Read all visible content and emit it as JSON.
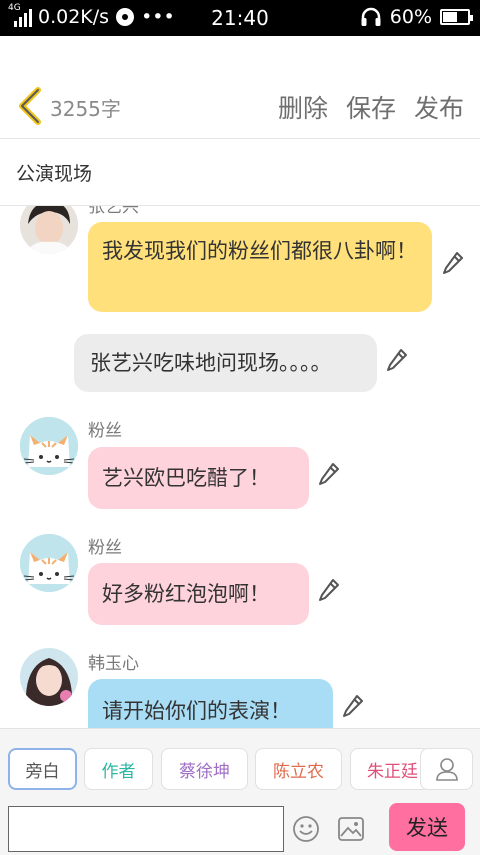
{
  "status_bar": {
    "network": "4G",
    "speed": "0.02K/s",
    "dots": "•••",
    "time": "21:40",
    "battery": "60%",
    "battery_level": 0.6
  },
  "header": {
    "word_count": "3255字",
    "delete": "删除",
    "save": "保存",
    "publish": "发布"
  },
  "title": "公演现场",
  "messages": [
    {
      "name": "张艺兴",
      "text": "我发现我们的粉丝们都很八卦啊！",
      "bubble_color": "#ffe07a"
    },
    {
      "name": "",
      "text": "张艺兴吃味地问现场。。。。",
      "bubble_color": "#ececec"
    },
    {
      "name": "粉丝",
      "text": "艺兴欧巴吃醋了！",
      "bubble_color": "#ffd3dc"
    },
    {
      "name": "粉丝",
      "text": "好多粉红泡泡啊！",
      "bubble_color": "#ffd3dc"
    },
    {
      "name": "韩玉心",
      "text": "请开始你们的表演！",
      "bubble_color": "#a9dcf5"
    }
  ],
  "roles": [
    {
      "label": "旁白",
      "color": "#555555"
    },
    {
      "label": "作者",
      "color": "#2bb7a4"
    },
    {
      "label": "蔡徐坤",
      "color": "#a06fc4"
    },
    {
      "label": "陈立农",
      "color": "#e06a4d"
    },
    {
      "label": "朱正廷",
      "color": "#e04f7a"
    }
  ],
  "input": {
    "value": "",
    "send": "发送"
  },
  "icons": [
    "back-chevron-icon",
    "pencil-icon",
    "contacts-icon",
    "emoji-icon",
    "image-icon"
  ]
}
